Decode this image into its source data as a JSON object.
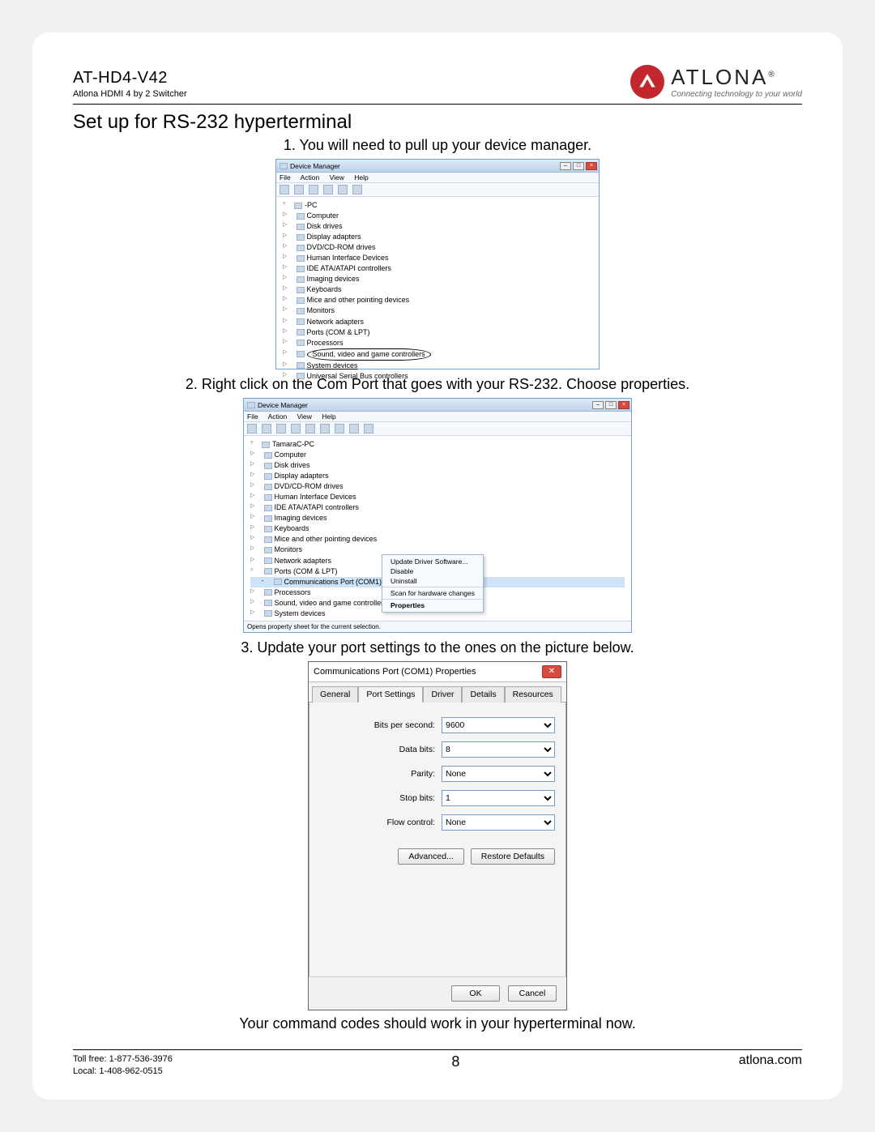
{
  "header": {
    "model": "AT-HD4-V42",
    "desc": "Atlona HDMI 4 by 2 Switcher",
    "brand": "ATLONA",
    "tagline": "Connecting technology to your world",
    "tm": "®"
  },
  "section_title": "Set up for RS-232 hyperterminal",
  "steps": {
    "s1": "1. You will need to pull up your device manager.",
    "s2": "2. Right click on the Com Port that goes with your RS-232. Choose properties.",
    "s3": "3. Update your port settings to the ones on the picture below.",
    "closing": "Your command codes should work in your hyperterminal now."
  },
  "devmgr": {
    "title": "Device Manager",
    "menu": {
      "file": "File",
      "action": "Action",
      "view": "View",
      "help": "Help"
    },
    "root1": "-PC",
    "root2": "TamaraC-PC",
    "nodes": {
      "computer": "Computer",
      "disk": "Disk drives",
      "display": "Display adapters",
      "dvd": "DVD/CD-ROM drives",
      "hid": "Human Interface Devices",
      "ide": "IDE ATA/ATAPI controllers",
      "imaging": "Imaging devices",
      "keyboards": "Keyboards",
      "mice": "Mice and other pointing devices",
      "monitors": "Monitors",
      "net": "Network adapters",
      "ports": "Ports (COM & LPT)",
      "comport": "Communications Port (COM1)",
      "cpu": "Processors",
      "sound": "Sound, video and game controllers",
      "system": "System devices",
      "usb": "Universal Serial Bus controllers"
    },
    "context": {
      "update": "Update Driver Software...",
      "disable": "Disable",
      "uninstall": "Uninstall",
      "scan": "Scan for hardware changes",
      "props": "Properties"
    },
    "status": "Opens property sheet for the current selection."
  },
  "dlg": {
    "title": "Communications Port (COM1) Properties",
    "tabs": {
      "general": "General",
      "port": "Port Settings",
      "driver": "Driver",
      "details": "Details",
      "resources": "Resources"
    },
    "labels": {
      "bps": "Bits per second:",
      "databits": "Data bits:",
      "parity": "Parity:",
      "stopbits": "Stop bits:",
      "flow": "Flow control:"
    },
    "values": {
      "bps": "9600",
      "databits": "8",
      "parity": "None",
      "stopbits": "1",
      "flow": "None"
    },
    "buttons": {
      "advanced": "Advanced...",
      "restore": "Restore Defaults",
      "ok": "OK",
      "cancel": "Cancel"
    }
  },
  "footer": {
    "tollfree": "Toll free: 1-877-536-3976",
    "local": "Local: 1-408-962-0515",
    "page": "8",
    "site": "atlona.com"
  }
}
